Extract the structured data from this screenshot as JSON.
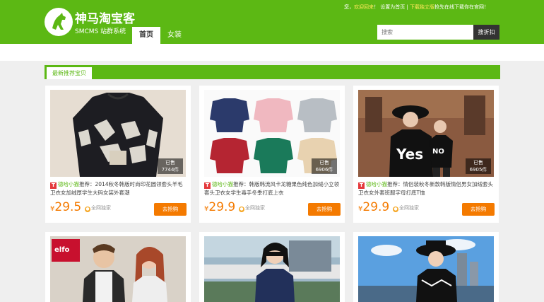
{
  "header": {
    "logo_title": "神马淘宝客",
    "logo_subtitle": "SMCMS 站群系统",
    "topbar_text": "您，",
    "topbar_welcome": "欢迎回来",
    "topbar_mid": "！ 设置为首页 | ",
    "topbar_guest": "下载独立版",
    "topbar_tail": "抢先在线下载你在官网！"
  },
  "nav": {
    "items": [
      "首页",
      "女装"
    ]
  },
  "search": {
    "placeholder": "搜索",
    "button_label": "搜折扣"
  },
  "section": {
    "title": "最新推荐宝贝"
  },
  "products": [
    {
      "tm": "T",
      "shop": "德哈小猫",
      "title_rest": "推荐：2014秋冬韩版时尚印花圆领套头羊毛卫衣女加绒厚学生大码女装外套潮",
      "currency": "¥",
      "price": "29.5",
      "net": "全网独家",
      "sold_label": "已售",
      "sold_count": "7744件",
      "buy": "去抢购"
    },
    {
      "tm": "T",
      "shop": "德哈小猫",
      "title_rest": "推荐：韩版韩流风卡龙糖果色纯色加绒小立领套头卫衣女学生毒手冬季打底上衣",
      "currency": "¥",
      "price": "29.9",
      "net": "全网独家",
      "sold_label": "已售",
      "sold_count": "6906件",
      "buy": "去抢购"
    },
    {
      "tm": "T",
      "shop": "德哈小猫",
      "title_rest": "推荐：情侣装秋冬新款韩版情侣男女加绒套头卫衣女外套班服字母打底T恤",
      "currency": "¥",
      "price": "29.9",
      "net": "全网独家",
      "sold_label": "已售",
      "sold_count": "6905件",
      "buy": "去抢购"
    }
  ],
  "colors": {
    "brand_green": "#5cb814",
    "price_orange": "#f47a00",
    "tmall_red": "#e4393c"
  }
}
